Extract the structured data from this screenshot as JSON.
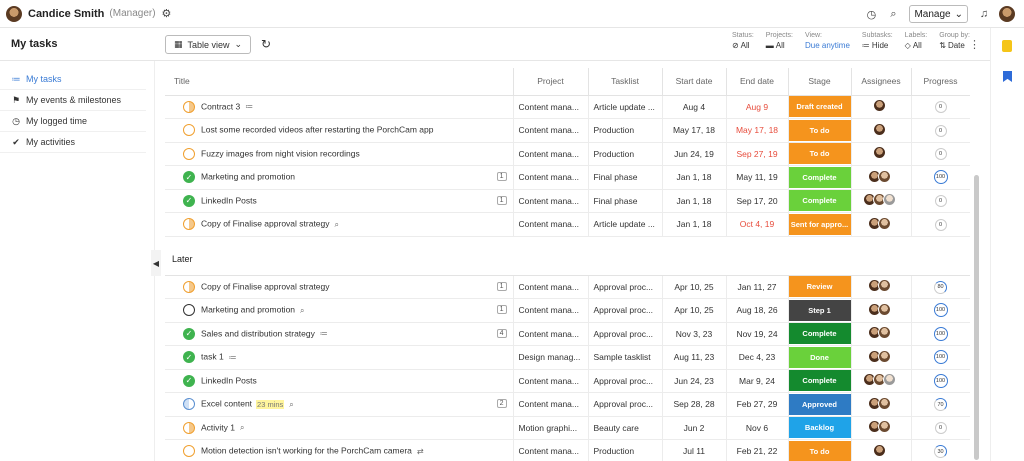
{
  "user": {
    "name": "Candice Smith",
    "role": "(Manager)"
  },
  "header": {
    "manage_label": "Manage"
  },
  "page": {
    "title": "My tasks",
    "view_label": "Table view"
  },
  "filters": [
    {
      "label": "Status:",
      "value": "All",
      "icon": "check-circle-icon"
    },
    {
      "label": "Projects:",
      "value": "All",
      "icon": "folder-icon"
    },
    {
      "label": "View:",
      "value": "Due anytime",
      "icon": ""
    },
    {
      "label": "Subtasks:",
      "value": "Hide",
      "icon": "list-icon"
    },
    {
      "label": "Labels:",
      "value": "All",
      "icon": "tag-icon"
    },
    {
      "label": "Group by:",
      "value": "Date",
      "icon": "sort-icon"
    }
  ],
  "sidebar": {
    "items": [
      {
        "label": "My tasks",
        "icon": "list-icon",
        "active": true
      },
      {
        "label": "My events & milestones",
        "icon": "flag-icon",
        "active": false
      },
      {
        "label": "My logged time",
        "icon": "clock-icon",
        "active": false
      },
      {
        "label": "My activities",
        "icon": "check-icon",
        "active": false
      }
    ]
  },
  "columns": [
    "Title",
    "Project",
    "Tasklist",
    "Start date",
    "End date",
    "Stage",
    "Assignees",
    "Progress"
  ],
  "groups": [
    {
      "label": "",
      "rows": [
        {
          "title": "Contract 3",
          "status": "half",
          "sub": "≔",
          "count": "",
          "tag": "",
          "project": "Content mana...",
          "tasklist": "Article update ...",
          "start": "Aug 4",
          "end": "Aug 9",
          "late": true,
          "stage": "Draft created",
          "stage_color": "#f5941d",
          "assignees": 1,
          "progress": "0"
        },
        {
          "title": "Lost some recorded videos after restarting the PorchCam app",
          "status": "open",
          "sub": "",
          "count": "",
          "tag": "",
          "project": "Content mana...",
          "tasklist": "Production",
          "start": "May 17, 18",
          "end": "May 17, 18",
          "late": true,
          "stage": "To do",
          "stage_color": "#f5941d",
          "assignees": 1,
          "progress": "0"
        },
        {
          "title": "Fuzzy images from night vision recordings",
          "status": "open",
          "sub": "",
          "count": "",
          "tag": "",
          "project": "Content mana...",
          "tasklist": "Production",
          "start": "Jun 24, 19",
          "end": "Sep 27, 19",
          "late": true,
          "stage": "To do",
          "stage_color": "#f5941d",
          "assignees": 1,
          "progress": "0"
        },
        {
          "title": "Marketing and promotion",
          "status": "done",
          "sub": "",
          "count": "1",
          "tag": "",
          "project": "Content mana...",
          "tasklist": "Final phase",
          "start": "Jan 1, 18",
          "end": "May 11, 19",
          "late": false,
          "stage": "Complete",
          "stage_color": "#6ad13b",
          "assignees": 2,
          "progress": "100"
        },
        {
          "title": "LinkedIn Posts",
          "status": "done",
          "sub": "",
          "count": "1",
          "tag": "",
          "project": "Content mana...",
          "tasklist": "Final phase",
          "start": "Jan 1, 18",
          "end": "Sep 17, 20",
          "late": false,
          "stage": "Complete",
          "stage_color": "#6ad13b",
          "assignees": 3,
          "progress": "0"
        },
        {
          "title": "Copy of Finalise approval strategy",
          "status": "half",
          "sub": "⌕",
          "count": "",
          "tag": "",
          "project": "Content mana...",
          "tasklist": "Article update ...",
          "start": "Jan 1, 18",
          "end": "Oct 4, 19",
          "late": true,
          "stage": "Sent for appro...",
          "stage_color": "#f5941d",
          "assignees": 2,
          "progress": "0"
        }
      ]
    },
    {
      "label": "Later",
      "rows": [
        {
          "title": "Copy of Finalise approval strategy",
          "status": "half",
          "sub": "",
          "count": "1",
          "tag": "",
          "project": "Content mana...",
          "tasklist": "Approval proc...",
          "start": "Apr 10, 25",
          "end": "Jan 11, 27",
          "late": false,
          "stage": "Review",
          "stage_color": "#f5941d",
          "assignees": 2,
          "progress": "80"
        },
        {
          "title": "Marketing and promotion",
          "status": "dark",
          "sub": "⌕",
          "count": "1",
          "tag": "",
          "project": "Content mana...",
          "tasklist": "Approval proc...",
          "start": "Apr 10, 25",
          "end": "Aug 18, 26",
          "late": false,
          "stage": "Step 1",
          "stage_color": "#444444",
          "assignees": 2,
          "progress": "100"
        },
        {
          "title": "Sales and distribution strategy",
          "status": "done",
          "sub": "≔",
          "count": "4",
          "tag": "",
          "project": "Content mana...",
          "tasklist": "Approval proc...",
          "start": "Nov 3, 23",
          "end": "Nov 19, 24",
          "late": false,
          "stage": "Complete",
          "stage_color": "#148a2e",
          "assignees": 2,
          "progress": "100"
        },
        {
          "title": "task 1",
          "status": "done",
          "sub": "≔",
          "count": "",
          "tag": "",
          "project": "Design manag...",
          "tasklist": "Sample tasklist",
          "start": "Aug 11, 23",
          "end": "Dec 4, 23",
          "late": false,
          "stage": "Done",
          "stage_color": "#6ad13b",
          "assignees": 2,
          "progress": "100"
        },
        {
          "title": "LinkedIn Posts",
          "status": "done",
          "sub": "",
          "count": "",
          "tag": "",
          "project": "Content mana...",
          "tasklist": "Approval proc...",
          "start": "Jun 24, 23",
          "end": "Mar 9, 24",
          "late": false,
          "stage": "Complete",
          "stage_color": "#148a2e",
          "assignees": 3,
          "progress": "100"
        },
        {
          "title": "Excel content",
          "status": "blue",
          "sub": "⌕",
          "count": "2",
          "tag": "23 mins",
          "project": "Content mana...",
          "tasklist": "Approval proc...",
          "start": "Sep 28, 28",
          "end": "Feb 27, 29",
          "late": false,
          "stage": "Approved",
          "stage_color": "#2e7bc4",
          "assignees": 2,
          "progress": "70"
        },
        {
          "title": "Activity 1",
          "status": "half",
          "sub": "⌕",
          "count": "",
          "tag": "",
          "project": "Motion graphi...",
          "tasklist": "Beauty care",
          "start": "Jun 2",
          "end": "Nov 6",
          "late": false,
          "stage": "Backlog",
          "stage_color": "#1fa3e8",
          "assignees": 2,
          "progress": "0"
        },
        {
          "title": "Motion detection isn't working for the PorchCam camera",
          "status": "open",
          "sub": "⇄",
          "count": "",
          "tag": "",
          "project": "Content mana...",
          "tasklist": "Production",
          "start": "Jul 11",
          "end": "Feb 21, 22",
          "late": false,
          "stage": "To do",
          "stage_color": "#f5941d",
          "assignees": 1,
          "progress": "30"
        }
      ]
    }
  ]
}
